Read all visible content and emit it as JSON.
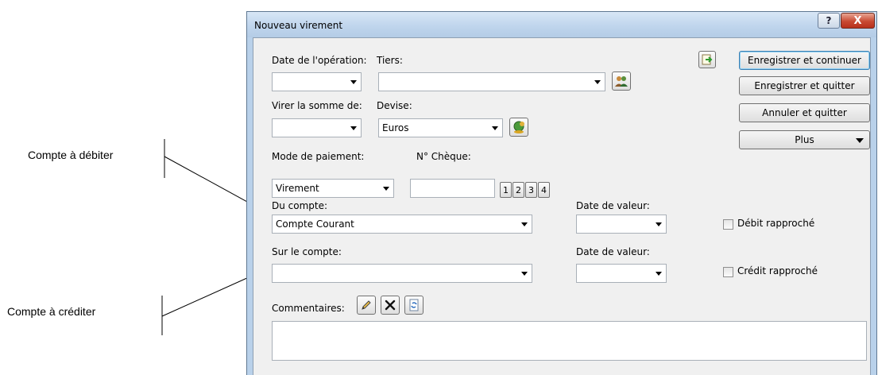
{
  "annotations": {
    "debit_account": "Compte à débiter",
    "credit_account": "Compte à créditer"
  },
  "window": {
    "title": "Nouveau virement",
    "help_glyph": "?",
    "close_glyph": "X"
  },
  "form": {
    "date_label": "Date de l'opération:",
    "date_value": "",
    "tiers_label": "Tiers:",
    "tiers_value": "",
    "amount_label": "Virer la somme de:",
    "amount_value": "",
    "currency_label": "Devise:",
    "currency_value": "Euros",
    "payment_mode_label": "Mode de paiement:",
    "payment_mode_value": "Virement",
    "cheque_label": "N° Chèque:",
    "cheque_value": "",
    "cheque_buttons": [
      "1",
      "2",
      "3",
      "4"
    ],
    "from_account_label": "Du compte:",
    "from_account_value": "Compte Courant",
    "value_date_label_1": "Date de valeur:",
    "value_date_value_1": "",
    "debit_reconciled_label": "Débit rapproché",
    "to_account_label": "Sur le compte:",
    "to_account_value": "",
    "value_date_label_2": "Date de valeur:",
    "value_date_value_2": "",
    "credit_reconciled_label": "Crédit rapproché",
    "comments_label": "Commentaires:",
    "comments_value": ""
  },
  "buttons": {
    "save_continue": "Enregistrer et continuer",
    "save_quit": "Enregistrer et quitter",
    "cancel_quit": "Annuler et quitter",
    "more": "Plus"
  },
  "icons": {
    "tiers": "people-icon",
    "currency": "currency-coins-icon",
    "export": "export-document-icon",
    "edit": "pencil-icon",
    "delete": "x-icon",
    "refresh": "refresh-document-icon"
  }
}
